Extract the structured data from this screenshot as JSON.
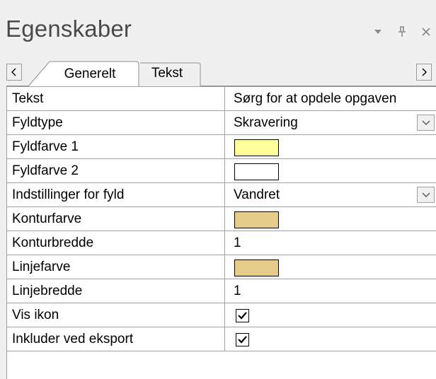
{
  "panel": {
    "title": "Egenskaber",
    "icons": [
      "dropdown-arrow-icon",
      "pin-icon",
      "close-icon"
    ]
  },
  "tabs": {
    "items": [
      {
        "label": "Generelt",
        "active": true
      },
      {
        "label": "Tekst",
        "active": false
      }
    ],
    "scroll_left_icon": "scroll-left-icon",
    "scroll_right_icon": "scroll-right-icon"
  },
  "properties": [
    {
      "name": "Tekst",
      "value": "Sørg for at opdele opgaven",
      "kind": "text"
    },
    {
      "name": "Fyldtype",
      "value": "Skravering",
      "kind": "dropdown"
    },
    {
      "name": "Fyldfarve 1",
      "value": "",
      "kind": "color",
      "color": "#ffff99"
    },
    {
      "name": "Fyldfarve 2",
      "value": "",
      "kind": "color",
      "color": "#ffffff"
    },
    {
      "name": "Indstillinger for fyld",
      "value": "Vandret",
      "kind": "dropdown"
    },
    {
      "name": "Konturfarve",
      "value": "",
      "kind": "color",
      "color": "#e5cc8a"
    },
    {
      "name": "Konturbredde",
      "value": "1",
      "kind": "text"
    },
    {
      "name": "Linjefarve",
      "value": "",
      "kind": "color",
      "color": "#e5cc8a"
    },
    {
      "name": "Linjebredde",
      "value": "1",
      "kind": "text"
    },
    {
      "name": "Vis ikon",
      "value": "",
      "kind": "checkbox",
      "checked": true
    },
    {
      "name": "Inkluder ved eksport",
      "value": "",
      "kind": "checkbox",
      "checked": true
    }
  ]
}
